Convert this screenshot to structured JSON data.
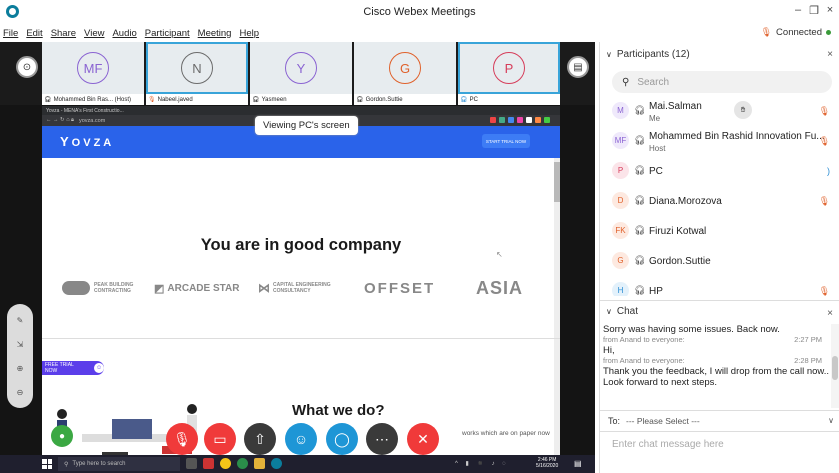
{
  "window": {
    "title": "Cisco Webex Meetings",
    "minimize_glyph": "–",
    "restore_glyph": "❐",
    "close_glyph": "×"
  },
  "menu": [
    "File",
    "Edit",
    "Share",
    "View",
    "Audio",
    "Participant",
    "Meeting",
    "Help"
  ],
  "connection": {
    "status": "Connected",
    "dot_color": "#3a9a3a"
  },
  "thumbnails": [
    {
      "initials": "MF",
      "name": "Mohammed Bin Ras... (Host)",
      "color": "#8a63d2",
      "active": false
    },
    {
      "initials": "N",
      "name": "Nabeel.javed",
      "color": "#6b6b6b",
      "active": true
    },
    {
      "initials": "Y",
      "name": "Yasmeen",
      "color": "#8a63d2",
      "active": false
    },
    {
      "initials": "G",
      "name": "Gordon.Suttie",
      "color": "#e0612b",
      "active": false
    },
    {
      "initials": "P",
      "name": "PC",
      "color": "#d63d5a",
      "active": true
    }
  ],
  "share": {
    "banner": "Viewing PC's screen",
    "tab_title": "Yovza - MENA's First Constructio...",
    "url": "yovza.com",
    "brand": "OVZA",
    "start_trial": "START TRIAL NOW",
    "heading": "You are in good company",
    "logos": [
      "PEAK BUILDING CONTRACTING",
      "ARCADE STAR",
      "CAPITAL ENGINEERING CONSULTANCY",
      "OFFSET",
      "ASIA"
    ],
    "free_trial": "FREE TRIAL NOW",
    "what_we_do": "What we do?",
    "what_desc": "works which are on paper now"
  },
  "taskbar": {
    "search_placeholder": "Type here to search",
    "time": "2:46 PM",
    "date": "5/16/2020"
  },
  "participants": {
    "header": "Participants (12)",
    "search_placeholder": "Search",
    "list": [
      {
        "initials": "M",
        "name": "Mai.Salman",
        "role": "Me",
        "color": "#8a63d2",
        "bg": "#efe9fb",
        "mic": "muted"
      },
      {
        "initials": "MF",
        "name": "Mohammed Bin Rashid Innovation Fu...",
        "role": "Host",
        "color": "#8a63d2",
        "bg": "#efe9fb",
        "mic": "muted"
      },
      {
        "initials": "P",
        "name": "PC",
        "role": "",
        "color": "#d63d5a",
        "bg": "#fbe4e9",
        "mic": "active"
      },
      {
        "initials": "D",
        "name": "Diana.Morozova",
        "role": "",
        "color": "#e0612b",
        "bg": "#fde9e0",
        "mic": "muted"
      },
      {
        "initials": "FK",
        "name": "Firuzi Kotwal",
        "role": "",
        "color": "#e0612b",
        "bg": "#fde9e0",
        "mic": ""
      },
      {
        "initials": "G",
        "name": "Gordon.Suttie",
        "role": "",
        "color": "#e0612b",
        "bg": "#fde9e0",
        "mic": ""
      },
      {
        "initials": "H",
        "name": "HP",
        "role": "",
        "color": "#2a8dd4",
        "bg": "#e3f1fb",
        "mic": "muted"
      }
    ]
  },
  "chat": {
    "header": "Chat",
    "messages": [
      {
        "text": "Sorry was having some issues. Back now.",
        "from": "",
        "time": ""
      },
      {
        "text": "",
        "from": "from Anand to everyone:",
        "time": "2:27 PM"
      },
      {
        "text": "Hi,",
        "from": "",
        "time": ""
      },
      {
        "text": "",
        "from": "from Anand to everyone:",
        "time": "2:28 PM"
      },
      {
        "text": "Thank you the feedback, I will drop from the call now..",
        "from": "",
        "time": ""
      },
      {
        "text": "Look forward to next steps.",
        "from": "",
        "time": ""
      }
    ],
    "to_label": "To:",
    "to_value": "--- Please Select ---",
    "input_placeholder": "Enter chat message here"
  }
}
